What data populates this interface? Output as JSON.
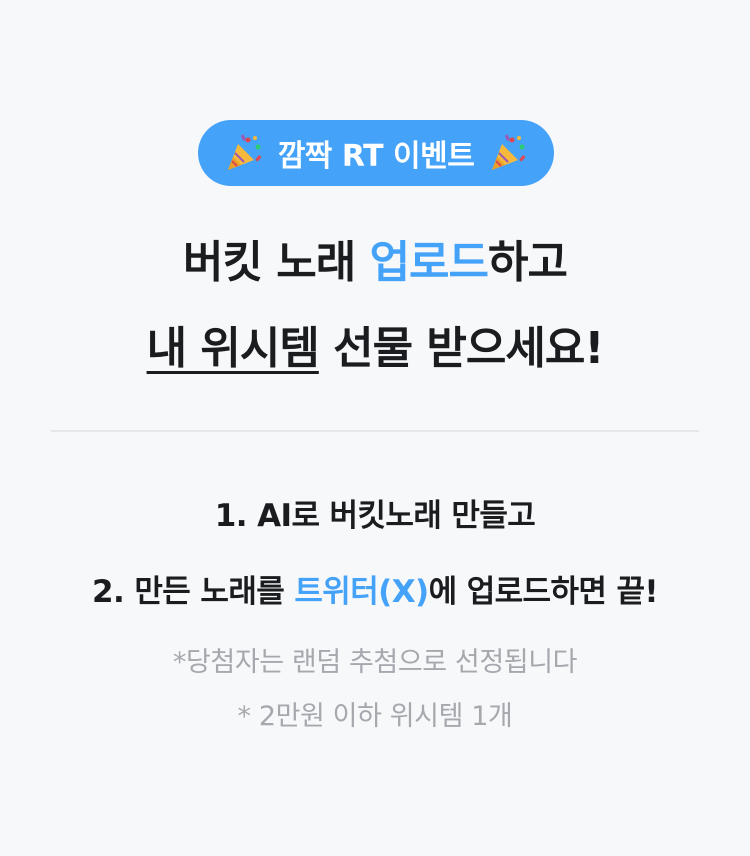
{
  "badge": {
    "text": "깜짝 RT 이벤트",
    "left_icon": "party-popper-icon",
    "right_icon": "party-popper-icon",
    "background": "#45a2f9"
  },
  "headline": {
    "line1_part1": "버킷 노래 ",
    "line1_accent": "업로드",
    "line1_part2": "하고",
    "line2_underlined": "내 위시템",
    "line2_rest": " 선물 받으세요!"
  },
  "steps": {
    "step1": "1. AI로 버킷노래 만들고",
    "step2_part1": "2. 만든 노래를 ",
    "step2_accent": "트위터(X)",
    "step2_part2": "에 업로드하면 끝!"
  },
  "notes": {
    "note1": "*당첨자는 랜덤 추첨으로 선정됩니다",
    "note2": "* 2만원 이하 위시템 1개"
  },
  "colors": {
    "accent": "#45a2f9",
    "text": "#1b1c1f",
    "muted": "#a5a8ad",
    "background": "#f7f8fa"
  }
}
